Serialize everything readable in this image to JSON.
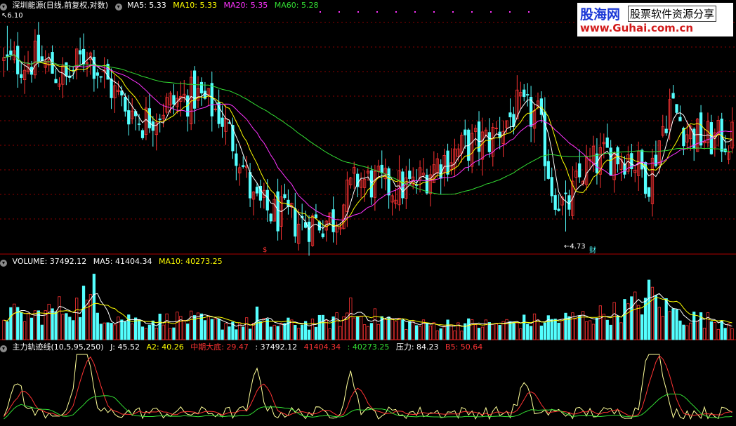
{
  "headers": {
    "price": {
      "title": "深圳能源(日线,前复权,对数)",
      "ma": [
        {
          "text": "MA5: 5.33",
          "color": "#ffffff"
        },
        {
          "text": "MA10: 5.33",
          "color": "#ffff00"
        },
        {
          "text": "MA20: 5.35",
          "color": "#ff33ff"
        },
        {
          "text": "MA60: 5.28",
          "color": "#33dd33"
        }
      ]
    },
    "volume": {
      "items": [
        {
          "text": "VOLUME: 37492.12",
          "color": "#ffffff"
        },
        {
          "text": "MA5: 41404.34",
          "color": "#ffffff"
        },
        {
          "text": "MA10: 40273.25",
          "color": "#ffff00"
        }
      ]
    },
    "indicator": {
      "items": [
        {
          "text": "主力轨迹线(10,5,95,250)",
          "color": "#ffffff"
        },
        {
          "text": "J: 45.52",
          "color": "#ffffff"
        },
        {
          "text": "A2: 40.26",
          "color": "#ffff00"
        },
        {
          "text": "中期大底: 29.47",
          "color": "#ff3333"
        },
        {
          "text": ": 37492.12",
          "color": "#ffffff"
        },
        {
          "text": "41404.34",
          "color": "#ff3333"
        },
        {
          "text": ": 40273.25",
          "color": "#33dd33"
        },
        {
          "text": "压力: 84.23",
          "color": "#ffffff"
        },
        {
          "text": "B5: 50.64",
          "color": "#ff3333"
        }
      ]
    }
  },
  "logo": {
    "brand": "股海网",
    "slogan": "股票软件资源分享",
    "url": "www.Guhai.com.cn"
  },
  "colors": {
    "up": "#ff3333",
    "down": "#54ffff",
    "ma5": "#ffffff",
    "ma10": "#ffff00",
    "ma20": "#ff33ff",
    "ma60": "#33dd33",
    "grid": "#8b0000",
    "separator": "#b00000"
  },
  "chart_data": [
    {
      "type": "candlestick",
      "title": "深圳能源(日线,前复权,对数)",
      "log_scale": true,
      "ylim": [
        4.6,
        6.2
      ],
      "annotations": [
        {
          "label": "6.10",
          "bar": 1,
          "value": 6.1
        },
        {
          "label": "4.73",
          "bar": 162,
          "value": 4.73
        }
      ],
      "markers": [
        {
          "label": "$",
          "bar": 75,
          "color": "#ff3333"
        },
        {
          "label": "财",
          "bar": 168,
          "color": "#54ffff"
        }
      ],
      "trend_anchors": [
        [
          0,
          5.82
        ],
        [
          10,
          5.85
        ],
        [
          18,
          5.7
        ],
        [
          24,
          5.92
        ],
        [
          28,
          5.75
        ],
        [
          34,
          5.55
        ],
        [
          40,
          5.42
        ],
        [
          46,
          5.52
        ],
        [
          55,
          5.6
        ],
        [
          62,
          5.48
        ],
        [
          68,
          5.2
        ],
        [
          72,
          4.9
        ],
        [
          76,
          4.85
        ],
        [
          86,
          4.78
        ],
        [
          95,
          4.8
        ],
        [
          102,
          5.05
        ],
        [
          110,
          5.0
        ],
        [
          118,
          5.0
        ],
        [
          125,
          5.15
        ],
        [
          133,
          5.25
        ],
        [
          140,
          5.3
        ],
        [
          148,
          5.5
        ],
        [
          154,
          5.45
        ],
        [
          158,
          5.0
        ],
        [
          162,
          4.85
        ],
        [
          167,
          5.1
        ],
        [
          174,
          5.2
        ],
        [
          180,
          5.2
        ],
        [
          186,
          5.05
        ],
        [
          192,
          5.55
        ],
        [
          197,
          5.35
        ],
        [
          203,
          5.3
        ],
        [
          210,
          5.3
        ]
      ],
      "ma_periods": [
        5,
        10,
        20,
        60
      ]
    },
    {
      "type": "bar",
      "title": "VOLUME",
      "value_range": [
        0,
        120000
      ],
      "volume_profile": [
        [
          0,
          45000
        ],
        [
          8,
          38000
        ],
        [
          16,
          52000
        ],
        [
          24,
          58000
        ],
        [
          30,
          40000
        ],
        [
          40,
          30000
        ],
        [
          52,
          35000
        ],
        [
          60,
          28000
        ],
        [
          72,
          26000
        ],
        [
          80,
          25000
        ],
        [
          95,
          30000
        ],
        [
          100,
          42000
        ],
        [
          110,
          34000
        ],
        [
          120,
          24000
        ],
        [
          130,
          26000
        ],
        [
          140,
          25000
        ],
        [
          150,
          30000
        ],
        [
          160,
          33000
        ],
        [
          170,
          40000
        ],
        [
          176,
          45000
        ],
        [
          182,
          58000
        ],
        [
          186,
          70000
        ],
        [
          190,
          55000
        ],
        [
          196,
          38000
        ],
        [
          204,
          32000
        ],
        [
          210,
          30000
        ]
      ],
      "series": [
        {
          "name": "VOLUME",
          "last": 37492.12
        },
        {
          "name": "MA5",
          "last": 41404.34
        },
        {
          "name": "MA10",
          "last": 40273.25
        }
      ]
    },
    {
      "type": "line",
      "title": "主力轨迹线(10,5,95,250)",
      "value_range": [
        0,
        100
      ],
      "series": [
        {
          "name": "J",
          "last": 45.52
        },
        {
          "name": "A2",
          "last": 40.26
        },
        {
          "name": "中期大底",
          "last": 29.47
        },
        {
          "name": "压力",
          "last": 84.23
        },
        {
          "name": "B5",
          "last": 50.64
        }
      ]
    }
  ]
}
